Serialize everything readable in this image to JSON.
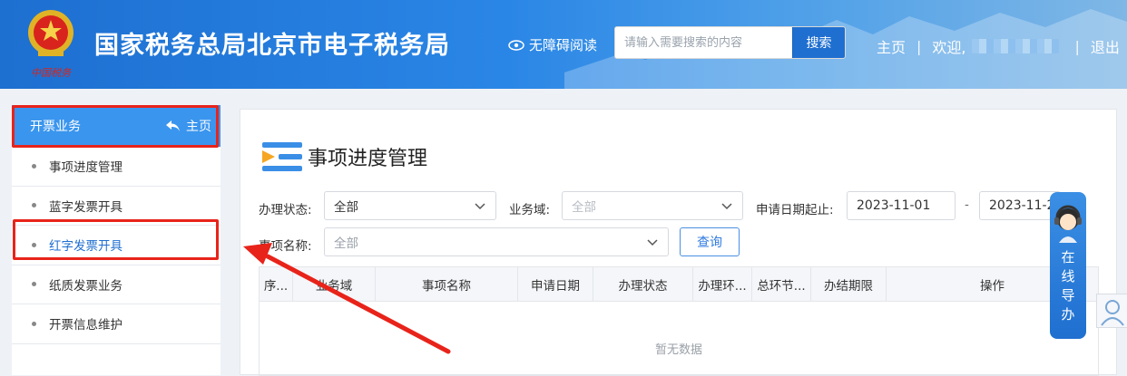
{
  "header": {
    "title": "国家税务总局北京市电子税务局",
    "accessibility": "无障碍阅读",
    "search_placeholder": "请输入需要搜索的内容",
    "search_button": "搜索",
    "nav_home": "主页",
    "nav_sep": "|",
    "nav_welcome": "欢迎,",
    "nav_logout": "退出",
    "logo_text": "中国税务"
  },
  "sidebar": {
    "section": "开票业务",
    "home": "主页",
    "items": [
      {
        "label": "事项进度管理"
      },
      {
        "label": "蓝字发票开具"
      },
      {
        "label": "红字发票开具"
      },
      {
        "label": "纸质发票业务"
      },
      {
        "label": "开票信息维护"
      }
    ]
  },
  "main": {
    "title": "事项进度管理",
    "filters": {
      "status_label": "办理状态:",
      "status_value": "全部",
      "domain_label": "业务域:",
      "domain_value": "全部",
      "date_label": "申请日期起止:",
      "date_start": "2023-11-01",
      "date_sep": "-",
      "date_end": "2023-11-2",
      "item_label": "事项名称:",
      "item_value": "全部",
      "query_button": "查询"
    },
    "table": {
      "headers": [
        "序...",
        "业务域",
        "事项名称",
        "申请日期",
        "办理状态",
        "办理环...",
        "总环节...",
        "办结期限",
        "操作"
      ],
      "empty_text": "暂无数据"
    }
  },
  "guide": {
    "label": "在线导办"
  },
  "colors": {
    "header_blue": "#2a86e6",
    "sidebar_active": "#3a95ee",
    "annotation_red": "#e8231a"
  }
}
